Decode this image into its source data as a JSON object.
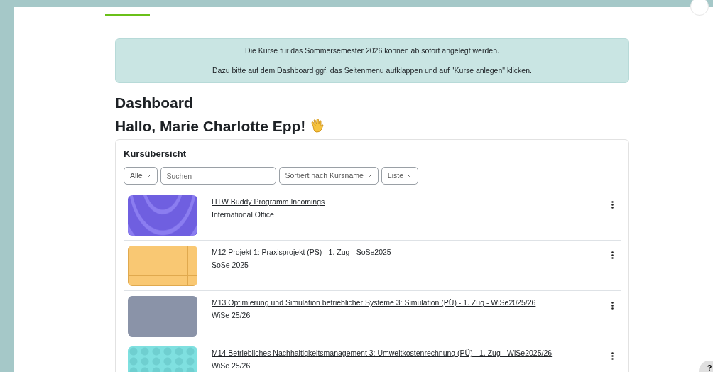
{
  "top_nav": {
    "tabs": [
      {
        "selected": true
      }
    ]
  },
  "notice": {
    "lines": [
      "Die Kurse für das Sommersemester 2026 können ab sofort angelegt werden.",
      "Dazu bitte auf dem Dashboard ggf. das Seitenmenu aufklappen und auf \"Kurse anlegen\" klicken."
    ]
  },
  "page_title": "Dashboard",
  "greeting": "Hallo, Marie Charlotte Epp!",
  "course_overview": {
    "title": "Kursübersicht",
    "filters": {
      "grouping": "Alle",
      "search": {
        "placeholder": "Suchen"
      },
      "sort": "Sortiert nach Kursname",
      "view": "Liste"
    },
    "courses": [
      {
        "name": "HTW Buddy Programm Incomings",
        "category": "International Office",
        "thumbnail": {
          "kind": "waves",
          "color": "#6f5fe0"
        }
      },
      {
        "name": "M12 Projekt 1: Praxisprojekt (PS) - 1. Zug - SoSe2025",
        "category": "SoSe 2025",
        "thumbnail": {
          "kind": "squares",
          "color": "#f9c873"
        }
      },
      {
        "name": "M13 Optimierung und Simulation betrieblicher Systeme 3: Simulation (PÜ) - 1. Zug - WiSe2025/26",
        "category": "WiSe 25/26",
        "thumbnail": {
          "kind": "photo",
          "color": "#8a93a8"
        }
      },
      {
        "name": "M14 Betriebliches Nachhaltigkeitsmanagement 3: Umweltkostenrechnung (PÜ) - 1. Zug - WiSe2025/26",
        "category": "WiSe 25/26",
        "thumbnail": {
          "kind": "hexagons",
          "color": "#7fe0e0"
        }
      }
    ]
  },
  "help_button": {
    "label": "?"
  }
}
